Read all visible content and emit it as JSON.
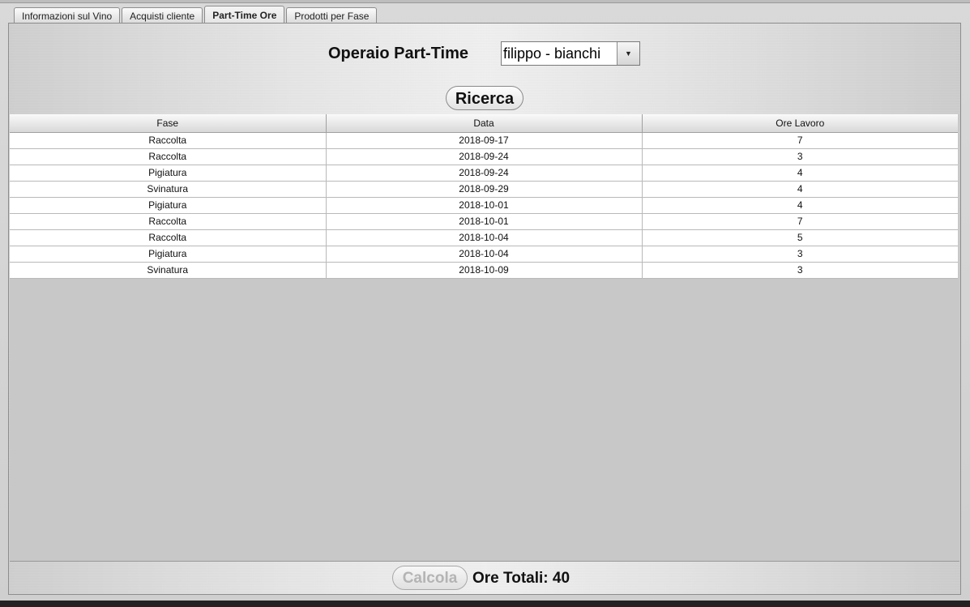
{
  "tabs": [
    {
      "label": "Informazioni sul Vino",
      "active": false
    },
    {
      "label": "Acquisti cliente",
      "active": false
    },
    {
      "label": "Part-Time Ore",
      "active": true
    },
    {
      "label": "Prodotti per Fase",
      "active": false
    }
  ],
  "form": {
    "operaio_label": "Operaio Part-Time",
    "operaio_selected": "filippo - bianchi",
    "search_button": "Ricerca"
  },
  "table": {
    "columns": [
      "Fase",
      "Data",
      "Ore Lavoro"
    ],
    "rows": [
      [
        "Raccolta",
        "2018-09-17",
        "7"
      ],
      [
        "Raccolta",
        "2018-09-24",
        "3"
      ],
      [
        "Pigiatura",
        "2018-09-24",
        "4"
      ],
      [
        "Svinatura",
        "2018-09-29",
        "4"
      ],
      [
        "Pigiatura",
        "2018-10-01",
        "4"
      ],
      [
        "Raccolta",
        "2018-10-01",
        "7"
      ],
      [
        "Raccolta",
        "2018-10-04",
        "5"
      ],
      [
        "Pigiatura",
        "2018-10-04",
        "3"
      ],
      [
        "Svinatura",
        "2018-10-09",
        "3"
      ]
    ]
  },
  "footer": {
    "calcola_button": "Calcola",
    "calcola_enabled": false,
    "ore_totali_label": "Ore Totali:",
    "ore_totali_value": "40"
  }
}
